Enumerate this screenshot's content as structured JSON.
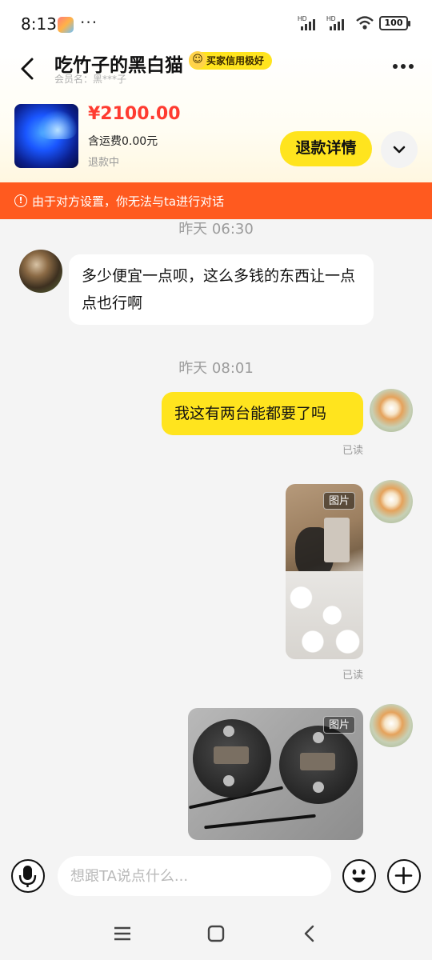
{
  "status_bar": {
    "time": "8:13",
    "dots": "···",
    "battery": "100",
    "signal_labels": [
      "HD",
      "HD"
    ]
  },
  "header": {
    "title": "吃竹子的黑白猫",
    "badge": "买家信用极好",
    "member_name": "会员名：黑***子"
  },
  "order": {
    "price": "¥2100.00",
    "shipping": "含运费0.00元",
    "status": "退款中",
    "refund_button": "退款详情"
  },
  "warning": {
    "icon": "!",
    "text": "由于对方设置，你无法与ta进行对话"
  },
  "messages": [
    {
      "time": "昨天 06:30",
      "side": "left",
      "text": "多少便宜一点呗，这么多钱的东西让一点点也行啊"
    },
    {
      "time": "昨天 08:01",
      "side": "right",
      "text": "我这有两台能都要了吗",
      "read": "已读"
    },
    {
      "side": "right",
      "type": "image",
      "tag": "图片",
      "read": "已读"
    },
    {
      "side": "right",
      "type": "image",
      "tag": "图片"
    }
  ],
  "input": {
    "placeholder": "想跟TA说点什么..."
  },
  "colors": {
    "accent_yellow": "#ffe41e",
    "warning_orange": "#ff5a1f",
    "price_red": "#ff3b30"
  }
}
